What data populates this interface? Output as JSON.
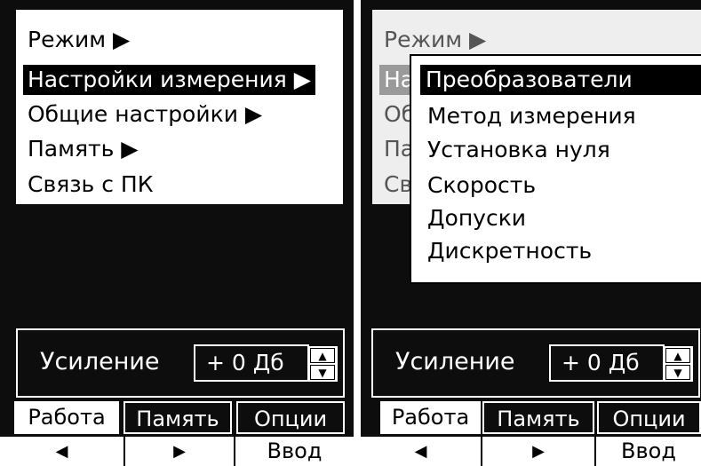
{
  "screen1": {
    "menu": [
      {
        "label": "Режим ▶"
      },
      {
        "label": "Настройки измерения ▶"
      },
      {
        "label": "Общие настройки ▶"
      },
      {
        "label": "Память ▶"
      },
      {
        "label": "Связь с ПК"
      }
    ],
    "selected_index": 1
  },
  "screen2": {
    "menu_behind": [
      {
        "label": "Режим ▶"
      },
      {
        "label": "На"
      },
      {
        "label": "Об"
      },
      {
        "label": "Па"
      },
      {
        "label": "Св"
      }
    ],
    "submenu": [
      {
        "label": "Преобразователи"
      },
      {
        "label": "Метод измерения"
      },
      {
        "label": "Установка нуля"
      },
      {
        "label": "Скорость"
      },
      {
        "label": "Допуски"
      },
      {
        "label": "Дискретность"
      }
    ],
    "submenu_selected_index": 0
  },
  "gain": {
    "label": "Усиление",
    "value": "+ 0 Дб"
  },
  "tabs": [
    {
      "label": "Работа"
    },
    {
      "label": "Память"
    },
    {
      "label": "Опции"
    }
  ],
  "active_tab_index": 0,
  "softkeys": [
    {
      "label": "◀"
    },
    {
      "label": "▶"
    },
    {
      "label": "Ввод"
    }
  ],
  "spin_icons": {
    "up": "▲",
    "down": "▼"
  },
  "colors": {
    "screen_bg": "#0d0d0d",
    "selection": "#000000",
    "dim_selection": "#9a9a9a"
  }
}
